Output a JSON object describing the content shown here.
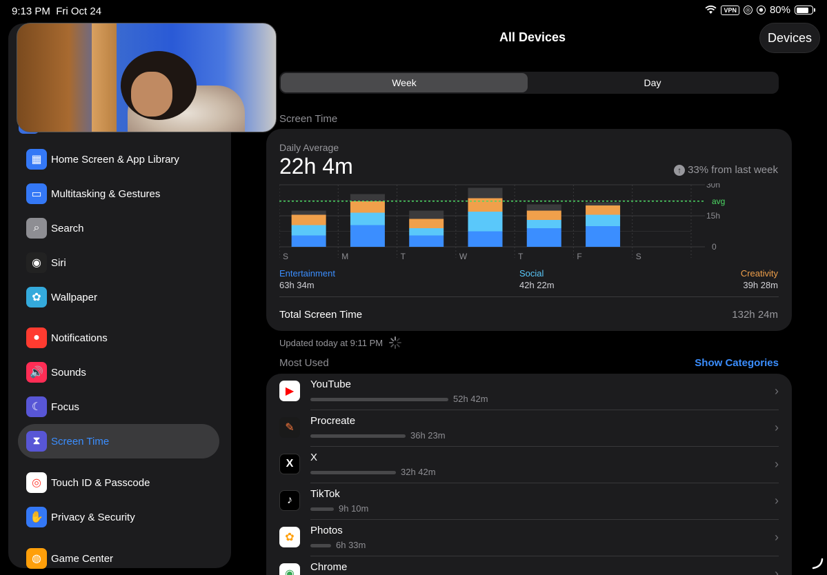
{
  "status_bar": {
    "time": "9:13 PM",
    "date": "Fri Oct 24",
    "vpn": "VPN",
    "battery": "80%"
  },
  "sidebar": {
    "items": [
      {
        "label": "Home Screen & App Library",
        "icon": "home-screen-icon",
        "color": "#3478f6"
      },
      {
        "label": "Multitasking & Gestures",
        "icon": "multitasking-icon",
        "color": "#3478f6"
      },
      {
        "label": "Search",
        "icon": "search-icon",
        "color": "#8e8e93"
      },
      {
        "label": "Siri",
        "icon": "siri-icon",
        "color": "#222222"
      },
      {
        "label": "Wallpaper",
        "icon": "wallpaper-icon",
        "color": "#34aadc"
      },
      {
        "label": "Notifications",
        "icon": "notifications-icon",
        "color": "#ff3b30"
      },
      {
        "label": "Sounds",
        "icon": "sounds-icon",
        "color": "#ff2d55"
      },
      {
        "label": "Focus",
        "icon": "focus-moon-icon",
        "color": "#5856d6"
      },
      {
        "label": "Screen Time",
        "icon": "hourglass-icon",
        "color": "#5856d6",
        "selected": true
      },
      {
        "label": "Touch ID & Passcode",
        "icon": "fingerprint-icon",
        "color": "#ffffff"
      },
      {
        "label": "Privacy & Security",
        "icon": "hand-icon",
        "color": "#3478f6"
      },
      {
        "label": "Game Center",
        "icon": "game-center-icon",
        "color": "#ff9f0a"
      }
    ]
  },
  "header": {
    "title": "All Devices",
    "devices_button": "Devices"
  },
  "segment": {
    "week": "Week",
    "day": "Day"
  },
  "screen_time_section": "Screen Time",
  "card": {
    "daily_average_label": "Daily Average",
    "daily_average_value": "22h 4m",
    "delta_text": "33% from last week",
    "categories": [
      {
        "name": "Entertainment",
        "value": "63h 34m",
        "color": "#3b8eff"
      },
      {
        "name": "Social",
        "value": "42h 22m",
        "color": "#5ac8fa"
      },
      {
        "name": "Creativity",
        "value": "39h 28m",
        "color": "#f0a04b"
      }
    ],
    "total_label": "Total Screen Time",
    "total_value": "132h 24m"
  },
  "chart_data": {
    "type": "bar",
    "stacked": true,
    "categories": [
      "S",
      "M",
      "T",
      "W",
      "T",
      "F",
      "S"
    ],
    "series": [
      {
        "name": "Entertainment",
        "color": "#3b8eff",
        "values": [
          5.5,
          10.5,
          5.5,
          7.5,
          9,
          10,
          0
        ]
      },
      {
        "name": "Social",
        "color": "#5ac8fa",
        "values": [
          5,
          6,
          3.5,
          9.5,
          4,
          5.5,
          0
        ]
      },
      {
        "name": "Creativity",
        "color": "#f0a04b",
        "values": [
          5,
          5.5,
          4.5,
          6.5,
          4.5,
          4.5,
          0
        ]
      },
      {
        "color": "#3a3a3c",
        "values": [
          2,
          3.5,
          4,
          5,
          3,
          1.5,
          0
        ]
      }
    ],
    "y_ticks": [
      "30h",
      "15h",
      "0"
    ],
    "avg_label": "avg",
    "avg_value": 22.07,
    "ylim": [
      0,
      30
    ]
  },
  "updated_text": "Updated today at 9:11 PM",
  "most_used": {
    "label": "Most Used",
    "show_categories": "Show Categories",
    "apps": [
      {
        "name": "YouTube",
        "time": "52h 42m",
        "fraction": 1.0,
        "icon": "youtube-icon",
        "bg": "#ffffff",
        "glyph": "▶",
        "fg": "#ff0000"
      },
      {
        "name": "Procreate",
        "time": "36h 23m",
        "fraction": 0.69,
        "icon": "procreate-icon",
        "bg": "#1a1a1a",
        "glyph": "✎",
        "fg": "#ff7a3d"
      },
      {
        "name": "X",
        "time": "32h 42m",
        "fraction": 0.62,
        "icon": "x-logo-icon",
        "bg": "#000000",
        "glyph": "X",
        "fg": "#ffffff"
      },
      {
        "name": "TikTok",
        "time": "9h 10m",
        "fraction": 0.17,
        "icon": "tiktok-icon",
        "bg": "#000000",
        "glyph": "♪",
        "fg": "#ffffff"
      },
      {
        "name": "Photos",
        "time": "6h 33m",
        "fraction": 0.12,
        "icon": "photos-icon",
        "bg": "#ffffff",
        "glyph": "✿",
        "fg": "#ff9f0a"
      },
      {
        "name": "Chrome",
        "time": "",
        "fraction": 0.08,
        "icon": "chrome-icon",
        "bg": "#ffffff",
        "glyph": "◉",
        "fg": "#34a853"
      }
    ]
  }
}
